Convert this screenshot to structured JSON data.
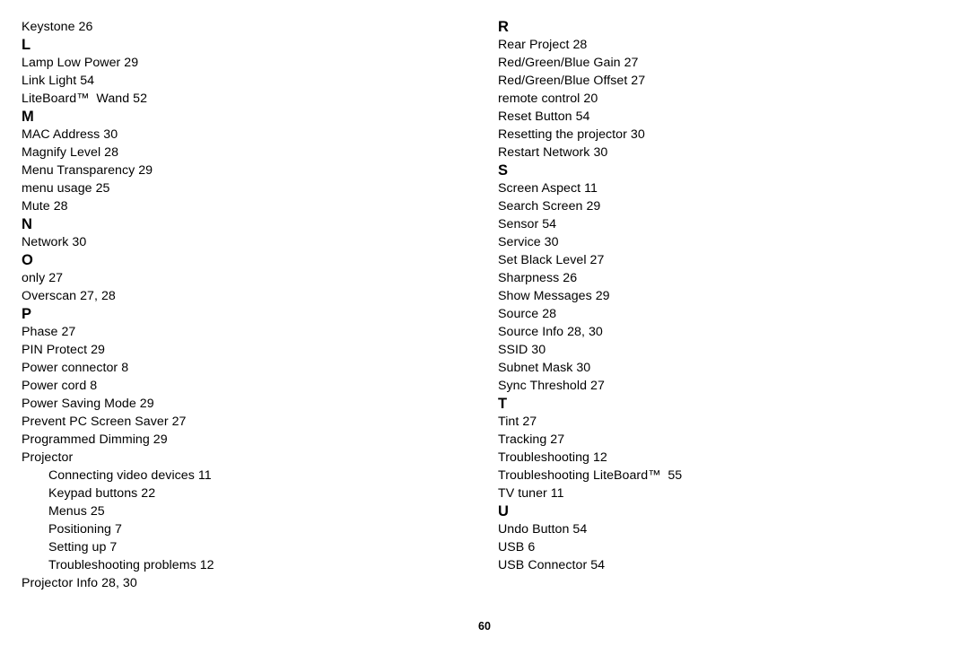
{
  "document": {
    "type": "book-index",
    "page_number": "60",
    "text_color": "#000000",
    "background_color": "#ffffff"
  },
  "columns": [
    {
      "id": "left",
      "blocks": [
        {
          "kind": "entry",
          "text": "Keystone 26",
          "indent": 0
        },
        {
          "kind": "letter",
          "text": "L"
        },
        {
          "kind": "entry",
          "text": "Lamp Low Power 29",
          "indent": 0
        },
        {
          "kind": "entry",
          "text": "Link Light 54",
          "indent": 0
        },
        {
          "kind": "entry",
          "text": "LiteBoard™  Wand 52",
          "indent": 0
        },
        {
          "kind": "letter",
          "text": "M"
        },
        {
          "kind": "entry",
          "text": "MAC Address 30",
          "indent": 0
        },
        {
          "kind": "entry",
          "text": "Magnify Level 28",
          "indent": 0
        },
        {
          "kind": "entry",
          "text": "Menu Transparency 29",
          "indent": 0
        },
        {
          "kind": "entry",
          "text": "menu usage 25",
          "indent": 0
        },
        {
          "kind": "entry",
          "text": "Mute 28",
          "indent": 0
        },
        {
          "kind": "letter",
          "text": "N"
        },
        {
          "kind": "entry",
          "text": "Network 30",
          "indent": 0
        },
        {
          "kind": "letter",
          "text": "O"
        },
        {
          "kind": "entry",
          "text": "only 27",
          "indent": 0
        },
        {
          "kind": "entry",
          "text": "Overscan 27, 28",
          "indent": 0
        },
        {
          "kind": "letter",
          "text": "P"
        },
        {
          "kind": "entry",
          "text": "Phase 27",
          "indent": 0
        },
        {
          "kind": "entry",
          "text": "PIN Protect 29",
          "indent": 0
        },
        {
          "kind": "entry",
          "text": "Power connector 8",
          "indent": 0
        },
        {
          "kind": "entry",
          "text": "Power cord 8",
          "indent": 0
        },
        {
          "kind": "entry",
          "text": "Power Saving Mode 29",
          "indent": 0
        },
        {
          "kind": "entry",
          "text": "Prevent PC Screen Saver 27",
          "indent": 0
        },
        {
          "kind": "entry",
          "text": "Programmed Dimming 29",
          "indent": 0
        },
        {
          "kind": "entry",
          "text": "Projector",
          "indent": 0
        },
        {
          "kind": "entry",
          "text": "Connecting video devices 11",
          "indent": 1
        },
        {
          "kind": "entry",
          "text": "Keypad buttons 22",
          "indent": 1
        },
        {
          "kind": "entry",
          "text": "Menus 25",
          "indent": 1
        },
        {
          "kind": "entry",
          "text": "Positioning 7",
          "indent": 1
        },
        {
          "kind": "entry",
          "text": "Setting up 7",
          "indent": 1
        },
        {
          "kind": "entry",
          "text": "Troubleshooting problems 12",
          "indent": 1
        },
        {
          "kind": "entry",
          "text": "Projector Info 28, 30",
          "indent": 0
        }
      ]
    },
    {
      "id": "right",
      "blocks": [
        {
          "kind": "letter",
          "text": "R"
        },
        {
          "kind": "entry",
          "text": "Rear Project 28",
          "indent": 0
        },
        {
          "kind": "entry",
          "text": "Red/Green/Blue Gain 27",
          "indent": 0
        },
        {
          "kind": "entry",
          "text": "Red/Green/Blue Offset 27",
          "indent": 0
        },
        {
          "kind": "entry",
          "text": "remote control 20",
          "indent": 0
        },
        {
          "kind": "entry",
          "text": "Reset Button 54",
          "indent": 0
        },
        {
          "kind": "entry",
          "text": "Resetting the projector 30",
          "indent": 0
        },
        {
          "kind": "entry",
          "text": "Restart Network 30",
          "indent": 0
        },
        {
          "kind": "letter",
          "text": "S"
        },
        {
          "kind": "entry",
          "text": "Screen Aspect 11",
          "indent": 0
        },
        {
          "kind": "entry",
          "text": "Search Screen 29",
          "indent": 0
        },
        {
          "kind": "entry",
          "text": "Sensor 54",
          "indent": 0
        },
        {
          "kind": "entry",
          "text": "Service 30",
          "indent": 0
        },
        {
          "kind": "entry",
          "text": "Set Black Level 27",
          "indent": 0
        },
        {
          "kind": "entry",
          "text": "Sharpness 26",
          "indent": 0
        },
        {
          "kind": "entry",
          "text": "Show Messages 29",
          "indent": 0
        },
        {
          "kind": "entry",
          "text": "Source 28",
          "indent": 0
        },
        {
          "kind": "entry",
          "text": "Source Info 28, 30",
          "indent": 0
        },
        {
          "kind": "entry",
          "text": "SSID 30",
          "indent": 0
        },
        {
          "kind": "entry",
          "text": "Subnet Mask 30",
          "indent": 0
        },
        {
          "kind": "entry",
          "text": "Sync Threshold 27",
          "indent": 0
        },
        {
          "kind": "letter",
          "text": "T"
        },
        {
          "kind": "entry",
          "text": "Tint 27",
          "indent": 0
        },
        {
          "kind": "entry",
          "text": "Tracking 27",
          "indent": 0
        },
        {
          "kind": "entry",
          "text": "Troubleshooting 12",
          "indent": 0
        },
        {
          "kind": "entry",
          "text": "Troubleshooting LiteBoard™  55",
          "indent": 0
        },
        {
          "kind": "entry",
          "text": "TV tuner 11",
          "indent": 0
        },
        {
          "kind": "letter",
          "text": "U"
        },
        {
          "kind": "entry",
          "text": "Undo Button 54",
          "indent": 0
        },
        {
          "kind": "entry",
          "text": "USB 6",
          "indent": 0
        },
        {
          "kind": "entry",
          "text": "USB Connector 54",
          "indent": 0
        }
      ]
    }
  ]
}
